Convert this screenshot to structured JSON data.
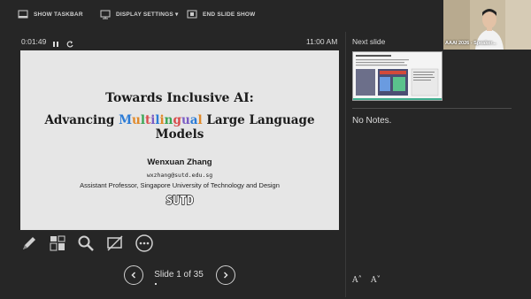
{
  "toolbar": {
    "show_taskbar": "SHOW TASKBAR",
    "display_settings": "DISPLAY SETTINGS ▾",
    "end_slide_show": "END SLIDE SHOW"
  },
  "timer": {
    "elapsed": "0:01:49",
    "clock": "11:00 AM"
  },
  "slide": {
    "title_line1": "Towards Inclusive AI:",
    "title_line2_prefix": "Advancing ",
    "title_line2_colored": [
      "M",
      "u",
      "l",
      "t",
      "i",
      "l",
      "i",
      "n",
      "g",
      "u",
      "a",
      "l"
    ],
    "title_line2_suffix": " Large Language Models",
    "letter_colors": [
      "#2b7bd6",
      "#e0892a",
      "#3aa655",
      "#d94c4c",
      "#7a5cc4",
      "#2b7bd6",
      "#e0892a",
      "#3aa655",
      "#d94c4c",
      "#7a5cc4",
      "#2b7bd6",
      "#e0892a"
    ],
    "author": "Wenxuan Zhang",
    "email": "wxzhang@sutd.edu.sg",
    "affiliation": "Assistant Professor, Singapore University of Technology and Design",
    "logo_text": "SUTD"
  },
  "tools": [
    "pen-tool",
    "slide-grid",
    "zoom",
    "camera-off",
    "more-options"
  ],
  "navigation": {
    "slide_counter": "Slide 1 of 35"
  },
  "right_pane": {
    "next_slide_label": "Next slide",
    "notes": "No Notes.",
    "font_increase": "A˄",
    "font_decrease": "A˅"
  },
  "webcam": {
    "caption": "AAAI 2026 - Speaker..."
  },
  "colors": {
    "background": "#262626",
    "slide_bg": "#e6e6e6",
    "text": "#d6d6d6"
  }
}
